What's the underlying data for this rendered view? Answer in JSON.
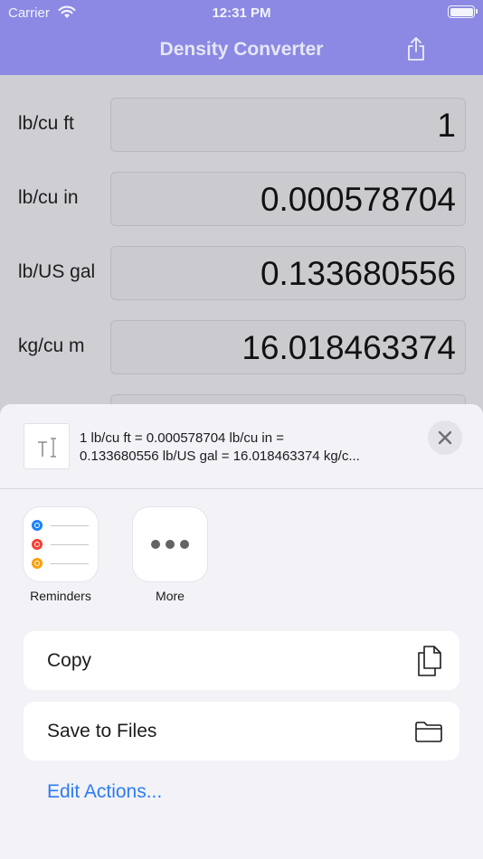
{
  "status_bar": {
    "carrier": "Carrier",
    "time": "12:31 PM"
  },
  "app": {
    "title": "Density Converter"
  },
  "rows": [
    {
      "unit": "lb/cu ft",
      "value": "1"
    },
    {
      "unit": "lb/cu in",
      "value": "0.000578704"
    },
    {
      "unit": "lb/US gal",
      "value": "0.133680556"
    },
    {
      "unit": "kg/cu m",
      "value": "16.018463374"
    }
  ],
  "share_sheet": {
    "preview_line1": "1 lb/cu ft = 0.000578704 lb/cu in =",
    "preview_line2": "0.133680556 lb/US gal = 16.018463374 kg/c...",
    "apps": [
      {
        "label": "Reminders",
        "icon": "reminders-icon"
      },
      {
        "label": "More",
        "icon": "more-icon"
      }
    ],
    "actions": [
      {
        "label": "Copy",
        "icon": "copy-icon"
      },
      {
        "label": "Save to Files",
        "icon": "folder-icon"
      }
    ],
    "edit_actions": "Edit Actions..."
  },
  "colors": {
    "header": "#8b89e3",
    "sheet_background": "#f2f2f7",
    "link": "#2d7cf6",
    "reminder_blue": "#1a82fb",
    "reminder_red": "#fb3b30",
    "reminder_orange": "#fd9f0a"
  }
}
